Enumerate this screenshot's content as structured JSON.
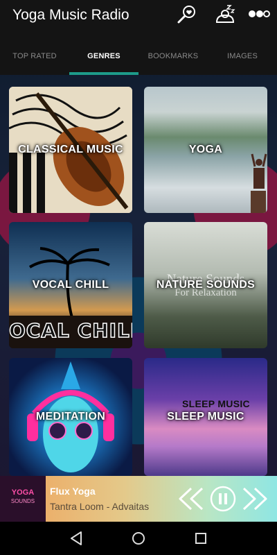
{
  "header": {
    "title": "Yoga Music Radio",
    "icons": [
      "search-heart-icon",
      "sleep-icon",
      "more-icon"
    ]
  },
  "tabs": [
    {
      "label": "TOP RATED",
      "active": false
    },
    {
      "label": "GENRES",
      "active": true
    },
    {
      "label": "BOOKMARKS",
      "active": false
    },
    {
      "label": "IMAGES",
      "active": false
    }
  ],
  "genres": [
    {
      "label": "CLASSICAL MUSIC"
    },
    {
      "label": "YOGA"
    },
    {
      "label": "VOCAL CHILL",
      "image_text": "OCAL CHILLOU"
    },
    {
      "label": "NATURE SOUNDS",
      "image_text": "Nature Sounds",
      "image_subtext": "For Relaxation"
    },
    {
      "label": "MEDITATION"
    },
    {
      "label": "SLEEP MUSIC",
      "image_text": "SLEEP MUSIC"
    }
  ],
  "player": {
    "art_text_top": "YOGA",
    "art_text_bottom": "SOUNDS",
    "title": "Flux Yoga",
    "subtitle": "Tantra Loom - Advaitas"
  },
  "colors": {
    "appbar": "#141414",
    "tab_indicator": "#1d9b8a"
  }
}
